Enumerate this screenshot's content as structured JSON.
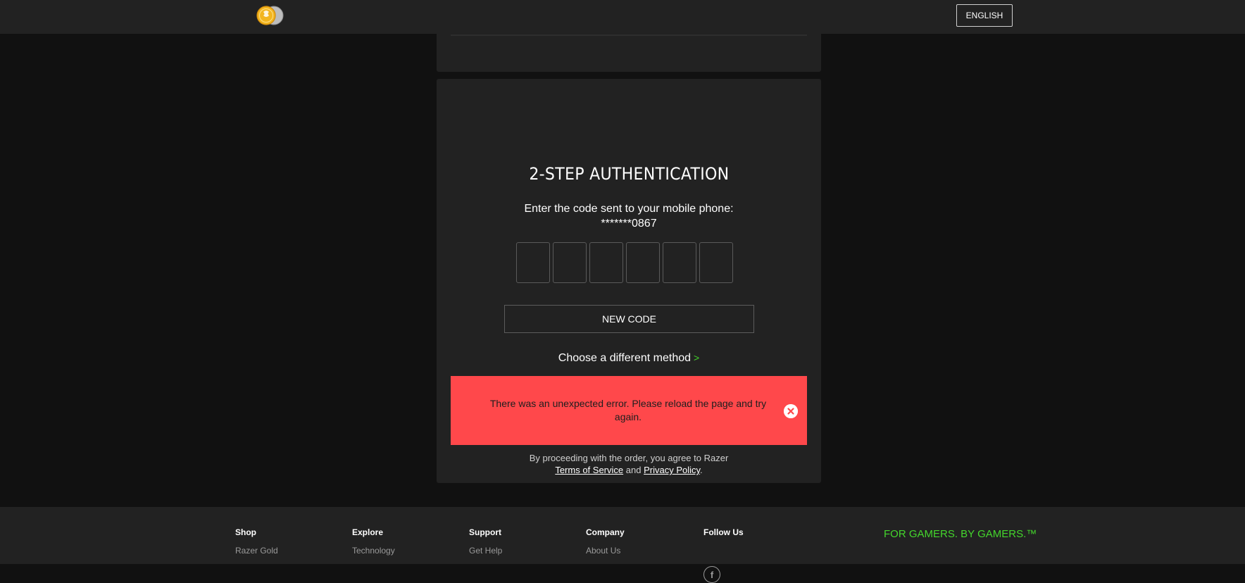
{
  "header": {
    "language_button": "ENGLISH"
  },
  "auth": {
    "title": "2-STEP AUTHENTICATION",
    "instruction": "Enter the code sent to your mobile phone:",
    "masked_phone": "*******0867",
    "code_digits": [
      "",
      "",
      "",
      "",
      "",
      ""
    ],
    "new_code_button": "NEW CODE",
    "different_method_link": "Choose a different method",
    "different_method_chevron": ">"
  },
  "error": {
    "message": "There was an unexpected error. Please reload the page and try again."
  },
  "legal": {
    "prefix": "By proceeding with the order, you agree to Razer",
    "terms_link": "Terms of Service",
    "conjunction": "and",
    "privacy_link": "Privacy Policy",
    "suffix": "."
  },
  "footer": {
    "columns": [
      {
        "heading": "Shop",
        "link": "Razer Gold"
      },
      {
        "heading": "Explore",
        "link": "Technology"
      },
      {
        "heading": "Support",
        "link": "Get Help"
      },
      {
        "heading": "Company",
        "link": "About Us"
      },
      {
        "heading": "Follow Us"
      }
    ],
    "slogan": "FOR GAMERS. BY GAMERS.™"
  },
  "colors": {
    "accent_green": "#44d62c",
    "error_red": "#ff484b",
    "card_bg": "#222222",
    "page_bg": "#111111"
  },
  "icons": [
    "razer-gold-coin-logo-icon",
    "close-circle-icon",
    "facebook-icon"
  ]
}
